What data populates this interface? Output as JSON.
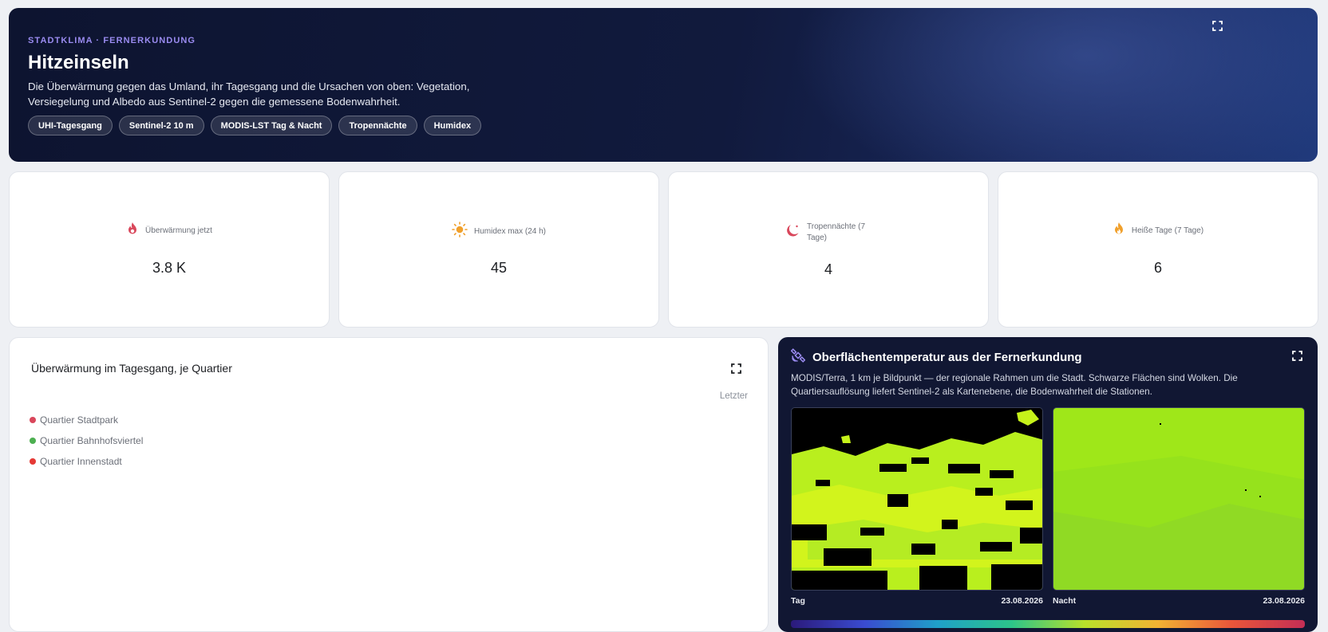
{
  "hero": {
    "eyebrow": "STADTKLIMA · FERNERKUNDUNG",
    "title": "Hitzeinseln",
    "description": "Die Überwärmung gegen das Umland, ihr Tagesgang und die Ursachen von oben: Vegetation, Versiegelung und Albedo aus Sentinel-2 gegen die gemessene Bodenwahrheit.",
    "chips": [
      "UHI-Tagesgang",
      "Sentinel-2 10 m",
      "MODIS-LST Tag & Nacht",
      "Tropennächte",
      "Humidex"
    ]
  },
  "kpis": [
    {
      "label": "Überwärmung jetzt",
      "value": "3.8 K",
      "icon": "flame-icon",
      "color": "#d9475b"
    },
    {
      "label": "Humidex max (24 h)",
      "value": "45",
      "icon": "sun-icon",
      "color": "#f0a02c"
    },
    {
      "label": "Tropennächte (7 Tage)",
      "value": "4",
      "icon": "moon-icon",
      "color": "#d9475b"
    },
    {
      "label": "Heiße Tage (7 Tage)",
      "value": "6",
      "icon": "fire-icon",
      "color": "#f0a02c"
    }
  ],
  "chart": {
    "title": "Überwärmung im Tagesgang, je Quartier",
    "latest_label": "Letzter",
    "series": [
      {
        "name": "Quartier Stadtpark",
        "color": "#d9475b"
      },
      {
        "name": "Quartier Bahnhofsviertel",
        "color": "#4caf50"
      },
      {
        "name": "Quartier Innenstadt",
        "color": "#e53935"
      }
    ]
  },
  "satellite": {
    "title": "Oberflächentemperatur aus der Fernerkundung",
    "description": "MODIS/Terra, 1 km je Bildpunkt — der regionale Rahmen um die Stadt. Schwarze Flächen sind Wolken. Die Quartiersauflösung liefert Sentinel-2 als Kartenebene, die Bodenwahrheit die Stationen.",
    "icon": "satellite-icon",
    "maps": [
      {
        "label": "Tag",
        "date": "23.08.2026"
      },
      {
        "label": "Nacht",
        "date": "23.08.2026"
      }
    ]
  },
  "colors": {
    "accent": "#9a8bf0",
    "hero_bg": "#111a3d",
    "panel_bg": "#111733"
  }
}
